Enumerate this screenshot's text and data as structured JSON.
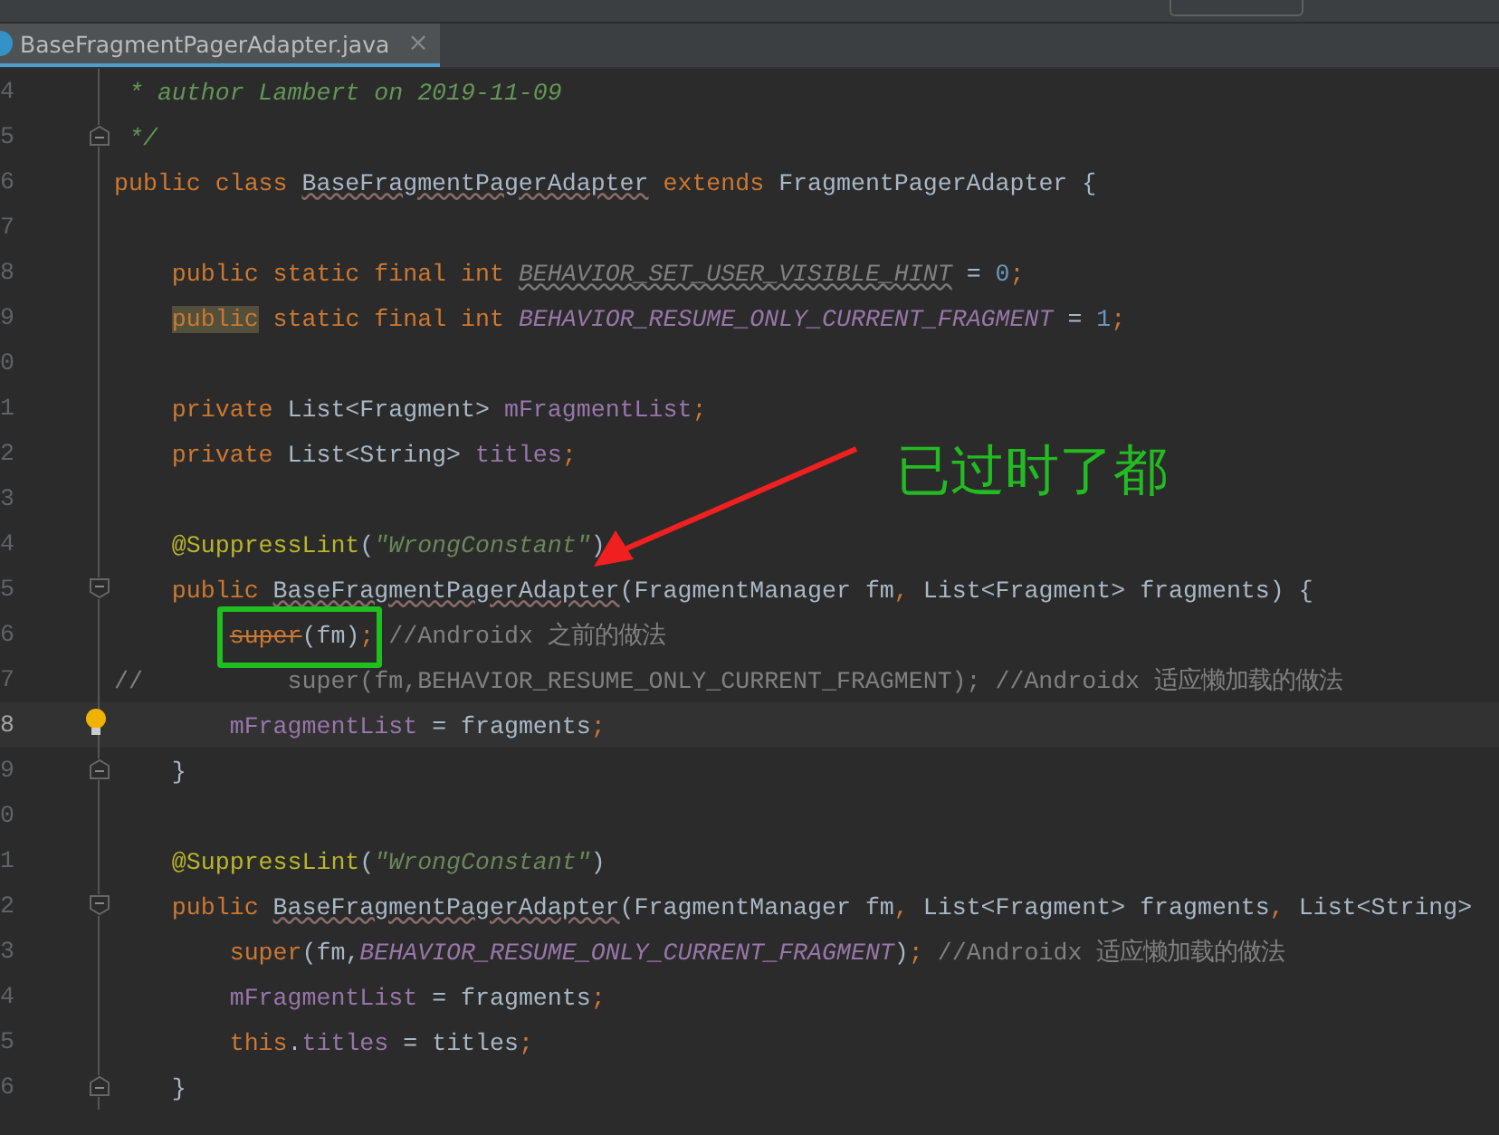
{
  "tabs": [
    {
      "label": "BaseFragmentPagerAdapter.java",
      "close": "×",
      "selected": true
    }
  ],
  "annotation": {
    "label": "已过时了都"
  },
  "editor": {
    "lines": [
      {
        "number": "4",
        "current": false,
        "kind": "code",
        "tokens": [
          {
            "kind": "doc",
            "text": " * author Lambert on 2019-11-09"
          }
        ]
      },
      {
        "number": "5",
        "current": false,
        "kind": "fold-end",
        "tokens": [
          {
            "kind": "doc",
            "text": " */"
          }
        ]
      },
      {
        "number": "6",
        "current": false,
        "kind": "code",
        "tokens": [
          {
            "kind": "keyword",
            "text": "public class "
          },
          {
            "kind": "warn",
            "text": "BaseFragmentPagerAdapter"
          },
          {
            "kind": "keyword",
            "text": " extends "
          },
          {
            "kind": "plain",
            "text": "FragmentPagerAdapter {"
          }
        ]
      },
      {
        "number": "7",
        "current": false,
        "kind": "code"
      },
      {
        "number": "8",
        "current": false,
        "kind": "code",
        "tokens": [
          {
            "kind": "keyword",
            "text": "    public static final int "
          },
          {
            "kind": "unused",
            "text": "BEHAVIOR_SET_USER_VISIBLE_HINT"
          },
          {
            "kind": "plain",
            "text": " = "
          },
          {
            "kind": "number",
            "text": "0"
          },
          {
            "kind": "keyword",
            "text": ";"
          }
        ]
      },
      {
        "number": "9",
        "current": false,
        "kind": "code",
        "tokens": [
          {
            "kind": "highlight",
            "text": "    public"
          },
          {
            "kind": "keyword",
            "text": " static final int "
          },
          {
            "kind": "constant",
            "text": "BEHAVIOR_RESUME_ONLY_CURRENT_FRAGMENT"
          },
          {
            "kind": "plain",
            "text": " = "
          },
          {
            "kind": "number",
            "text": "1"
          },
          {
            "kind": "keyword",
            "text": ";"
          }
        ]
      },
      {
        "number": "0",
        "current": false,
        "kind": "code"
      },
      {
        "number": "1",
        "current": false,
        "kind": "code",
        "tokens": [
          {
            "kind": "keyword",
            "text": "    private "
          },
          {
            "kind": "plain",
            "text": "List<Fragment> "
          },
          {
            "kind": "field",
            "text": "mFragmentList"
          },
          {
            "kind": "keyword",
            "text": ";"
          }
        ]
      },
      {
        "number": "2",
        "current": false,
        "kind": "code",
        "tokens": [
          {
            "kind": "keyword",
            "text": "    private "
          },
          {
            "kind": "plain",
            "text": "List<String> "
          },
          {
            "kind": "field",
            "text": "titles"
          },
          {
            "kind": "keyword",
            "text": ";"
          }
        ]
      },
      {
        "number": "3",
        "current": false,
        "kind": "code"
      },
      {
        "number": "4",
        "current": false,
        "kind": "code",
        "tokens": [
          {
            "kind": "annotation",
            "text": "    @SuppressLint"
          },
          {
            "kind": "plain",
            "text": "("
          },
          {
            "kind": "string",
            "text": "\"WrongConstant\""
          },
          {
            "kind": "plain",
            "text": ")"
          }
        ]
      },
      {
        "number": "5",
        "current": false,
        "kind": "fold-start",
        "tokens": [
          {
            "kind": "keyword",
            "text": "    public "
          },
          {
            "kind": "warn",
            "text": "BaseFragmentPagerAdapter"
          },
          {
            "kind": "plain",
            "text": "(FragmentManager fm"
          },
          {
            "kind": "keyword",
            "text": ", "
          },
          {
            "kind": "plain",
            "text": "List<Fragment> fragments) {"
          }
        ]
      },
      {
        "number": "6",
        "current": false,
        "kind": "code",
        "tokens": [
          {
            "kind": "deprecated",
            "text": "        super"
          },
          {
            "kind": "plain",
            "text": "(fm)"
          },
          {
            "kind": "keyword",
            "text": ";"
          },
          {
            "kind": "comment",
            "text": " //Androidx 之前的做法"
          }
        ]
      },
      {
        "number": "7",
        "current": false,
        "kind": "code",
        "tokens": [
          {
            "kind": "comment",
            "text": "//          super(fm,BEHAVIOR_RESUME_ONLY_CURRENT_FRAGMENT); //Androidx 适应懒加载的做法"
          }
        ]
      },
      {
        "number": "8",
        "current": true,
        "kind": "bulb",
        "tokens": [
          {
            "kind": "field",
            "text": "        mFragmentList"
          },
          {
            "kind": "plain",
            "text": " = fragments"
          },
          {
            "kind": "keyword",
            "text": ";"
          }
        ]
      },
      {
        "number": "9",
        "current": false,
        "kind": "fold-end",
        "tokens": [
          {
            "kind": "plain",
            "text": "    }"
          }
        ]
      },
      {
        "number": "0",
        "current": false,
        "kind": "code"
      },
      {
        "number": "1",
        "current": false,
        "kind": "code",
        "tokens": [
          {
            "kind": "annotation",
            "text": "    @SuppressLint"
          },
          {
            "kind": "plain",
            "text": "("
          },
          {
            "kind": "string",
            "text": "\"WrongConstant\""
          },
          {
            "kind": "plain",
            "text": ")"
          }
        ]
      },
      {
        "number": "2",
        "current": false,
        "kind": "fold-start",
        "tokens": [
          {
            "kind": "keyword",
            "text": "    public "
          },
          {
            "kind": "warn",
            "text": "BaseFragmentPagerAdapter"
          },
          {
            "kind": "plain",
            "text": "(FragmentManager fm"
          },
          {
            "kind": "keyword",
            "text": ", "
          },
          {
            "kind": "plain",
            "text": "List<Fragment> fragments"
          },
          {
            "kind": "keyword",
            "text": ", "
          },
          {
            "kind": "plain",
            "text": "List<String>"
          }
        ]
      },
      {
        "number": "3",
        "current": false,
        "kind": "code",
        "tokens": [
          {
            "kind": "keyword",
            "text": "        super"
          },
          {
            "kind": "plain",
            "text": "(fm,"
          },
          {
            "kind": "constant",
            "text": "BEHAVIOR_RESUME_ONLY_CURRENT_FRAGMENT"
          },
          {
            "kind": "plain",
            "text": ")"
          },
          {
            "kind": "keyword",
            "text": ";"
          },
          {
            "kind": "comment",
            "text": " //Androidx 适应懒加载的做法"
          }
        ]
      },
      {
        "number": "4",
        "current": false,
        "kind": "code",
        "tokens": [
          {
            "kind": "field",
            "text": "        mFragmentList"
          },
          {
            "kind": "plain",
            "text": " = fragments"
          },
          {
            "kind": "keyword",
            "text": ";"
          }
        ]
      },
      {
        "number": "5",
        "current": false,
        "kind": "code",
        "tokens": [
          {
            "kind": "keyword",
            "text": "        this"
          },
          {
            "kind": "plain",
            "text": "."
          },
          {
            "kind": "field",
            "text": "titles"
          },
          {
            "kind": "plain",
            "text": " = titles"
          },
          {
            "kind": "keyword",
            "text": ";"
          }
        ]
      },
      {
        "number": "6",
        "current": false,
        "kind": "fold-end",
        "tokens": [
          {
            "kind": "plain",
            "text": "    }"
          }
        ]
      }
    ]
  }
}
